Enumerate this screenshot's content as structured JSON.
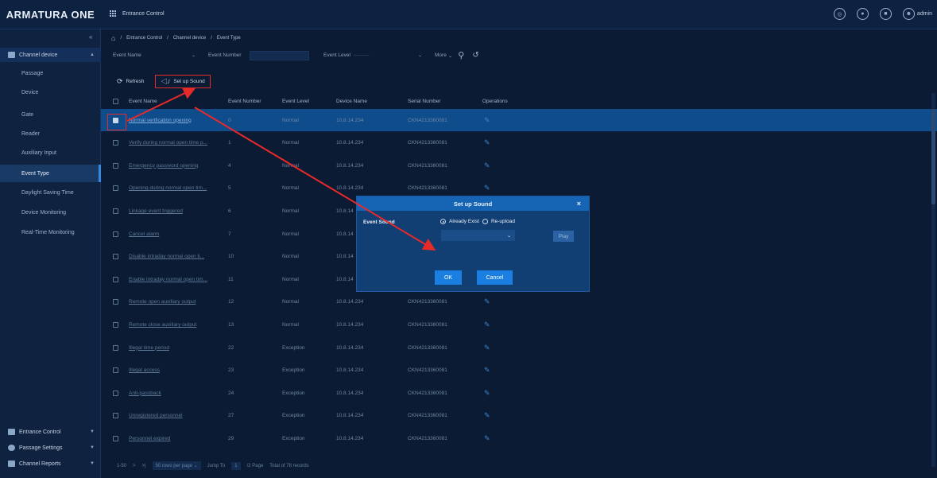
{
  "header": {
    "logo": "ARMATURA ONE",
    "module": "Entrance Control",
    "user": "admin"
  },
  "sidebar": {
    "collapse_label": "«",
    "group_open": "Channel device",
    "items": [
      "Passage",
      "Device",
      "Gate",
      "Reader",
      "Auxiliary Input",
      "Event Type",
      "Daylight Saving Time",
      "Device Monitoring",
      "Real-Time Monitoring"
    ],
    "active_item": "Event Type",
    "bottom_groups": [
      "Entrance Control",
      "Passage Settings",
      "Channel Reports"
    ]
  },
  "breadcrumb": {
    "home": "⌂",
    "items": [
      "Entrance Control",
      "Channel device",
      "Event Type"
    ],
    "separator": "/"
  },
  "filters": {
    "event_name": "Event Name",
    "event_number": "Event Number",
    "event_level": "Event Level",
    "more": "More"
  },
  "toolbar": {
    "refresh": "Refresh",
    "setup_sound": "Set up Sound"
  },
  "table": {
    "headers": [
      "Event Name",
      "Event Number",
      "Event Level",
      "Device Name",
      "Serial Number",
      "Operations"
    ],
    "rows": [
      {
        "name": "Normal verification opening",
        "number": "0",
        "level": "Normal",
        "device": "10.8.14.234",
        "serial": "CKN4213360081",
        "selected": true
      },
      {
        "name": "Verify during normal open time p...",
        "number": "1",
        "level": "Normal",
        "device": "10.8.14.234",
        "serial": "CKN4213360081",
        "selected": false
      },
      {
        "name": "Emergency password opening",
        "number": "4",
        "level": "Normal",
        "device": "10.8.14.234",
        "serial": "CKN4213360081",
        "selected": false
      },
      {
        "name": "Opening during normal open tim...",
        "number": "5",
        "level": "Normal",
        "device": "10.8.14.234",
        "serial": "CKN4213360081",
        "selected": false
      },
      {
        "name": "Linkage event triggered",
        "number": "6",
        "level": "Normal",
        "device": "10.8.14",
        "serial": "",
        "selected": false
      },
      {
        "name": "Cancel alarm",
        "number": "7",
        "level": "Normal",
        "device": "10.8.14",
        "serial": "",
        "selected": false
      },
      {
        "name": "Disable intraday normal open ti...",
        "number": "10",
        "level": "Normal",
        "device": "10.8.14",
        "serial": "",
        "selected": false
      },
      {
        "name": "Enable intraday normal open tim...",
        "number": "11",
        "level": "Normal",
        "device": "10.8.14",
        "serial": "",
        "selected": false
      },
      {
        "name": "Remote open auxiliary output",
        "number": "12",
        "level": "Normal",
        "device": "10.8.14.234",
        "serial": "CKN4213360081",
        "selected": false
      },
      {
        "name": "Remote close auxiliary output",
        "number": "13",
        "level": "Normal",
        "device": "10.8.14.234",
        "serial": "CKN4213360081",
        "selected": false
      },
      {
        "name": "Illegal time period",
        "number": "22",
        "level": "Exception",
        "device": "10.8.14.234",
        "serial": "CKN4213360081",
        "selected": false
      },
      {
        "name": "Illegal access",
        "number": "23",
        "level": "Exception",
        "device": "10.8.14.234",
        "serial": "CKN4213360081",
        "selected": false
      },
      {
        "name": "Anti-passback",
        "number": "24",
        "level": "Exception",
        "device": "10.8.14.234",
        "serial": "CKN4213360081",
        "selected": false
      },
      {
        "name": "Unregistered personnel",
        "number": "27",
        "level": "Exception",
        "device": "10.8.14.234",
        "serial": "CKN4213360081",
        "selected": false
      },
      {
        "name": "Personnel expired",
        "number": "29",
        "level": "Exception",
        "device": "10.8.14.234",
        "serial": "CKN4213360081",
        "selected": false
      }
    ]
  },
  "pagination": {
    "range": "1-50",
    "next": ">",
    "last": ">|",
    "per_page": "50 rows per page",
    "jump_label": "Jump To",
    "jump_value": "1",
    "page_info": "/2 Page",
    "total": "Total of 78 records"
  },
  "dialog": {
    "title": "Set up Sound",
    "close": "×",
    "label": "Event Sound",
    "option_exist": "Already Exist",
    "option_upload": "Re-upload",
    "play": "Play",
    "ok": "OK",
    "cancel": "Cancel"
  },
  "colors": {
    "accent": "#1a7fe0",
    "highlight": "#e52a2a",
    "background": "#0b1b33"
  }
}
